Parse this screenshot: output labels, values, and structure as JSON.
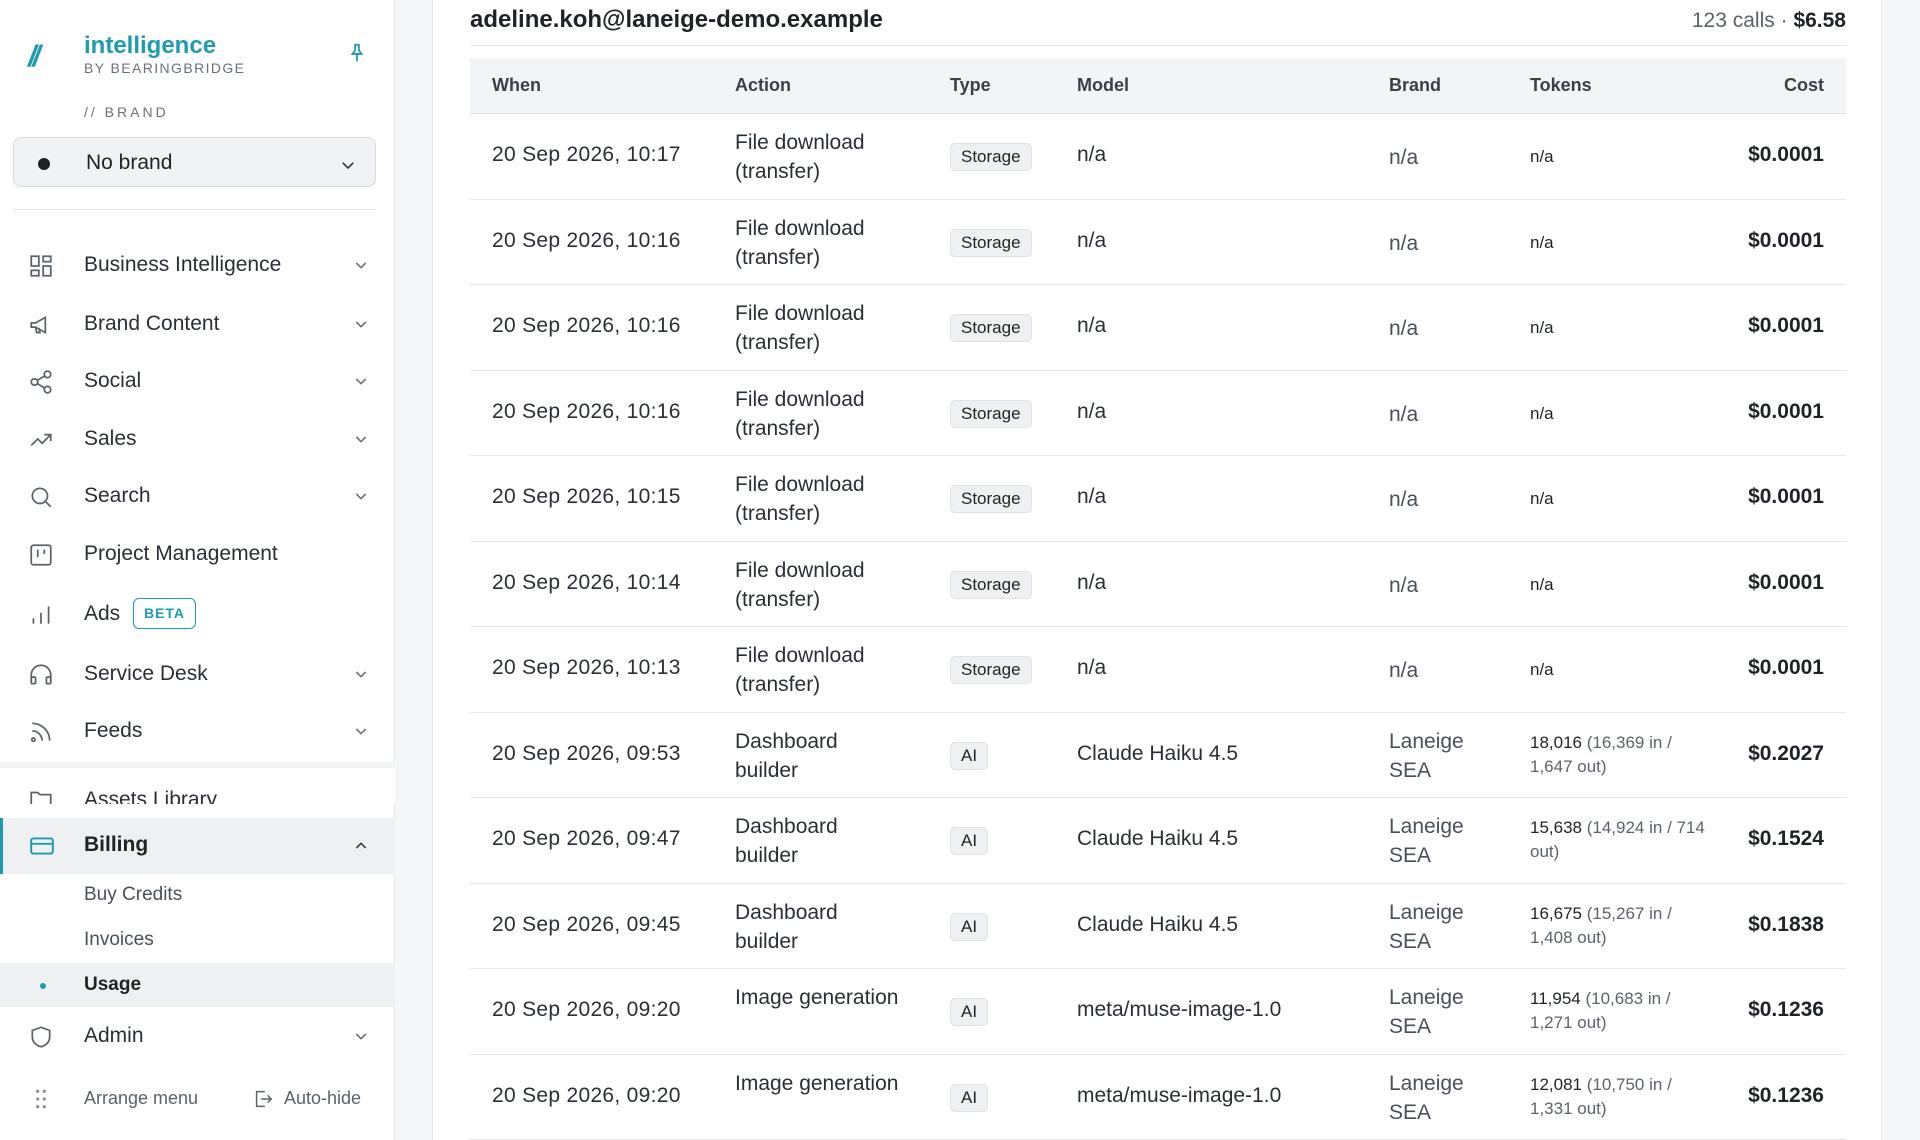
{
  "app": {
    "logo_mark": "//",
    "title": "intelligence",
    "subtitle": "BY BEARINGBRIDGE"
  },
  "brand_selector": {
    "label": "// BRAND",
    "value": "No brand"
  },
  "nav": {
    "business_intelligence": "Business Intelligence",
    "brand_content": "Brand Content",
    "social": "Social",
    "sales": "Sales",
    "search": "Search",
    "project_management": "Project Management",
    "ads": "Ads",
    "ads_badge": "BETA",
    "service_desk": "Service Desk",
    "feeds": "Feeds",
    "assets_library": "Assets Library",
    "billing": "Billing",
    "billing_sub": {
      "buy_credits": "Buy Credits",
      "invoices": "Invoices",
      "usage": "Usage"
    },
    "admin": "Admin"
  },
  "footer": {
    "arrange": "Arrange menu",
    "autohide": "Auto-hide"
  },
  "user": {
    "email": "adeline.koh@laneige-demo.example",
    "calls": "123 calls ·",
    "total": "$6.58"
  },
  "table": {
    "headers": {
      "when": "When",
      "action": "Action",
      "type": "Type",
      "model": "Model",
      "brand": "Brand",
      "tokens": "Tokens",
      "cost": "Cost"
    },
    "rows": [
      {
        "when": "20 Sep 2026, 10:17",
        "action": "File download (transfer)",
        "type": "Storage",
        "model": "n/a",
        "brand": "n/a",
        "tokens_total": "n/a",
        "tokens_detail": "",
        "cost": "$0.0001"
      },
      {
        "when": "20 Sep 2026, 10:16",
        "action": "File download (transfer)",
        "type": "Storage",
        "model": "n/a",
        "brand": "n/a",
        "tokens_total": "n/a",
        "tokens_detail": "",
        "cost": "$0.0001"
      },
      {
        "when": "20 Sep 2026, 10:16",
        "action": "File download (transfer)",
        "type": "Storage",
        "model": "n/a",
        "brand": "n/a",
        "tokens_total": "n/a",
        "tokens_detail": "",
        "cost": "$0.0001"
      },
      {
        "when": "20 Sep 2026, 10:16",
        "action": "File download (transfer)",
        "type": "Storage",
        "model": "n/a",
        "brand": "n/a",
        "tokens_total": "n/a",
        "tokens_detail": "",
        "cost": "$0.0001"
      },
      {
        "when": "20 Sep 2026, 10:15",
        "action": "File download (transfer)",
        "type": "Storage",
        "model": "n/a",
        "brand": "n/a",
        "tokens_total": "n/a",
        "tokens_detail": "",
        "cost": "$0.0001"
      },
      {
        "when": "20 Sep 2026, 10:14",
        "action": "File download (transfer)",
        "type": "Storage",
        "model": "n/a",
        "brand": "n/a",
        "tokens_total": "n/a",
        "tokens_detail": "",
        "cost": "$0.0001"
      },
      {
        "when": "20 Sep 2026, 10:13",
        "action": "File download (transfer)",
        "type": "Storage",
        "model": "n/a",
        "brand": "n/a",
        "tokens_total": "n/a",
        "tokens_detail": "",
        "cost": "$0.0001"
      },
      {
        "when": "20 Sep 2026, 09:53",
        "action": "Dashboard builder",
        "type": "AI",
        "model": "Claude Haiku 4.5",
        "brand": "Laneige SEA",
        "tokens_total": "18,016",
        "tokens_detail": "(16,369 in / 1,647 out)",
        "cost": "$0.2027"
      },
      {
        "when": "20 Sep 2026, 09:47",
        "action": "Dashboard builder",
        "type": "AI",
        "model": "Claude Haiku 4.5",
        "brand": "Laneige SEA",
        "tokens_total": "15,638",
        "tokens_detail": "(14,924 in / 714 out)",
        "cost": "$0.1524"
      },
      {
        "when": "20 Sep 2026, 09:45",
        "action": "Dashboard builder",
        "type": "AI",
        "model": "Claude Haiku 4.5",
        "brand": "Laneige SEA",
        "tokens_total": "16,675",
        "tokens_detail": "(15,267 in / 1,408 out)",
        "cost": "$0.1838"
      },
      {
        "when": "20 Sep 2026, 09:20",
        "action": "Image generation",
        "type": "AI",
        "model": "meta/muse-image-1.0",
        "brand": "Laneige SEA",
        "tokens_total": "11,954",
        "tokens_detail": "(10,683 in / 1,271 out)",
        "cost": "$0.1236"
      },
      {
        "when": "20 Sep 2026, 09:20",
        "action": "Image generation",
        "type": "AI",
        "model": "meta/muse-image-1.0",
        "brand": "Laneige SEA",
        "tokens_total": "12,081",
        "tokens_detail": "(10,750 in / 1,331 out)",
        "cost": "$0.1236"
      }
    ]
  },
  "colors": {
    "accent": "#1f9bb0",
    "text": "#1f2328",
    "muted": "#5c626a"
  }
}
